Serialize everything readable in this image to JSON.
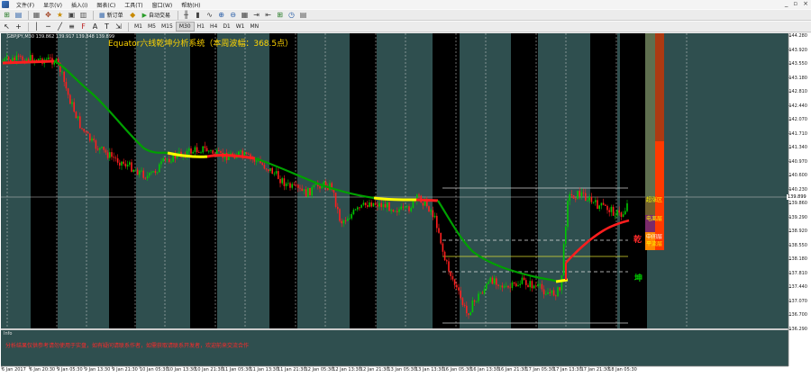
{
  "menu": {
    "items": [
      "文件(F)",
      "显示(V)",
      "插入(I)",
      "图表(C)",
      "工具(T)",
      "窗口(W)",
      "帮助(H)"
    ],
    "win_controls": [
      "_",
      "▫",
      "×"
    ]
  },
  "toolbar": {
    "new_order_label": "新订单",
    "auto_trade_label": "自动交易",
    "timeframes": [
      "M1",
      "M5",
      "M15",
      "M30",
      "H1",
      "H4",
      "D1",
      "W1",
      "MN"
    ]
  },
  "chart": {
    "symbol_line": "GBPJPY,M30  139.862 139.917 139.848 139.899",
    "title": "Equator六线乾坤分析系统（本周波幅：368.5点）",
    "labels": {
      "qian": "乾",
      "kun": "坤",
      "l1": "超涨区",
      "l2": "电离层",
      "l3": "中间层",
      "l4": "平流层"
    },
    "current_price": "139.899",
    "price_axis": [
      "144.280",
      "143.920",
      "143.550",
      "143.180",
      "142.810",
      "142.440",
      "142.070",
      "141.710",
      "141.340",
      "140.970",
      "140.600",
      "140.230",
      "139.860",
      "139.290",
      "138.920",
      "138.550",
      "138.180",
      "137.810",
      "137.440",
      "137.070",
      "136.700",
      "136.290"
    ],
    "time_axis": [
      "6 Jan 2017",
      "6 Jan 20:30",
      "9 Jan 05:30",
      "9 Jan 13:30",
      "9 Jan 21:30",
      "10 Jan 05:30",
      "10 Jan 13:30",
      "10 Jan 21:30",
      "11 Jan 05:30",
      "11 Jan 13:30",
      "11 Jan 21:30",
      "12 Jan 05:30",
      "12 Jan 13:30",
      "12 Jan 21:30",
      "13 Jan 05:30",
      "13 Jan 13:30",
      "16 Jan 05:30",
      "16 Jan 13:30",
      "16 Jan 21:30",
      "17 Jan 05:30",
      "17 Jan 13:30",
      "17 Jan 21:30",
      "18 Jan 05:30"
    ],
    "info_title": "Info",
    "info_text": "分析结果仅供参考请勿使用于实盘，如有疑问请联系作者，如需获取请联系开发者，欢迎前来交流合作"
  },
  "colors": {
    "chart_bg": "#2f4f4f",
    "night_band": "#000000",
    "bull": "#00c800",
    "bear": "#ff1e1e",
    "ma_green": "#00a000",
    "ma_yellow": "#ffff00",
    "title": "#ffd400"
  }
}
